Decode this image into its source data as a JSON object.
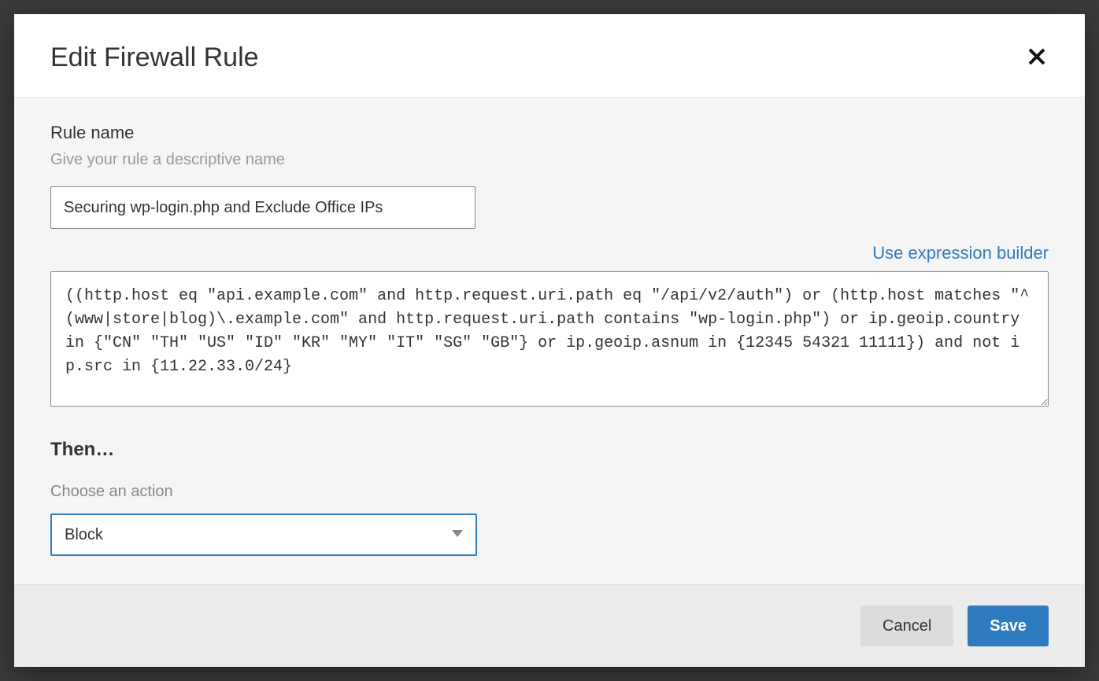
{
  "modal": {
    "title": "Edit Firewall Rule",
    "close_icon": "close-icon"
  },
  "ruleName": {
    "label": "Rule name",
    "hint": "Give your rule a descriptive name",
    "value": "Securing wp-login.php and Exclude Office IPs"
  },
  "builderLink": "Use expression builder",
  "expression": {
    "value": "((http.host eq \"api.example.com\" and http.request.uri.path eq \"/api/v2/auth\") or (http.host matches \"^(www|store|blog)\\.example.com\" and http.request.uri.path contains \"wp-login.php\") or ip.geoip.country in {\"CN\" \"TH\" \"US\" \"ID\" \"KR\" \"MY\" \"IT\" \"SG\" \"GB\"} or ip.geoip.asnum in {12345 54321 11111}) and not ip.src in {11.22.33.0/24}"
  },
  "then": {
    "heading": "Then…",
    "chooseLabel": "Choose an action",
    "selected": "Block"
  },
  "footer": {
    "cancel": "Cancel",
    "save": "Save"
  },
  "colors": {
    "accent": "#2f7bbf",
    "text": "#333333",
    "muted": "#999999",
    "body_bg": "#f5f5f5",
    "footer_bg": "#ececec"
  }
}
